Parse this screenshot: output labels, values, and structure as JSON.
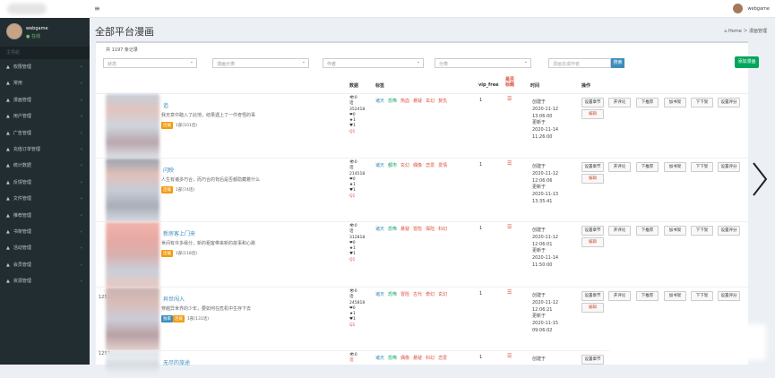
{
  "header": {
    "menu_icon": "≡",
    "user_name": "webgame"
  },
  "sidebar": {
    "user": {
      "name": "webgame",
      "status": "● 在线"
    },
    "nav_header": "主导航",
    "items": [
      {
        "icon": "▲",
        "label": "权限管理"
      },
      {
        "icon": "▲",
        "label": "常用"
      },
      {
        "icon": "▲",
        "label": "漫画管理"
      },
      {
        "icon": "▲",
        "label": "用户管理"
      },
      {
        "icon": "▲",
        "label": "广告管理"
      },
      {
        "icon": "▲",
        "label": "充值订单管理"
      },
      {
        "icon": "▲",
        "label": "统计数据"
      },
      {
        "icon": "▲",
        "label": "反馈管理"
      },
      {
        "icon": "▲",
        "label": "文件管理"
      },
      {
        "icon": "▲",
        "label": "推荐管理"
      },
      {
        "icon": "▲",
        "label": "书架管理"
      },
      {
        "icon": "▲",
        "label": "活动管理"
      },
      {
        "icon": "▲",
        "label": "会员管理"
      },
      {
        "icon": "▲",
        "label": "资源管理"
      }
    ]
  },
  "page": {
    "title": "全部平台漫画",
    "breadcrumb": "⌂ Home ＞ 漫画管理"
  },
  "toolbar": {
    "count": "共 1197 条记录",
    "filters": [
      "状态",
      "漫画分类",
      "作者",
      "分类"
    ],
    "keyword_placeholder": "漫画名或作者",
    "search_label": "搜索",
    "add_label": "添加漫画"
  },
  "table": {
    "headers": {
      "stats": "数据",
      "tags": "标签",
      "vip": "vip_free",
      "mark": "是否标题",
      "time": "时间",
      "ops": "操作"
    },
    "rows": [
      {
        "id": "",
        "title": "追",
        "intro": "我无意中踏入了此地，结果遇上了一件奇怪的事",
        "badges": [
          "连载"
        ],
        "note": "1部(101话)",
        "stats": [
          "👁0",
          "话",
          "352418",
          "❤0",
          "★1",
          "♥1",
          "Q1"
        ],
        "tags": [
          [
            "诸天",
            "blue"
          ],
          [
            "恐怖",
            "green"
          ],
          [
            "热血",
            "red"
          ],
          [
            "悬疑",
            "red"
          ],
          [
            "玄幻",
            "red"
          ],
          [
            "复仇",
            "red"
          ]
        ],
        "vip": "1",
        "mark": "☰",
        "times": [
          "创建于",
          "2020-11-12",
          "13:06:00",
          "更新于",
          "2020-11-14",
          "11:26:00"
        ],
        "ops": [
          "设置章节",
          "开评论",
          "下推荐",
          "加书架",
          "下下架",
          "设置评分",
          "编辑"
        ]
      },
      {
        "id": "",
        "title": "闪映",
        "intro": "人生有诸多巧合，而巧合的背后是否都隐藏着什么",
        "badges": [
          "连载"
        ],
        "note": "1部(74话)",
        "stats": [
          "👁0",
          "话",
          "214518",
          "❤0",
          "★1",
          "♥1",
          "Q1"
        ],
        "tags": [
          [
            "诸天",
            "blue"
          ],
          [
            "都市",
            "green"
          ],
          [
            "玄幻",
            "red"
          ],
          [
            "偶像",
            "red"
          ],
          [
            "恋爱",
            "red"
          ],
          [
            "爱情",
            "red"
          ]
        ],
        "vip": "1",
        "mark": "☰",
        "times": [
          "创建于",
          "2020-11-12",
          "12:06:06",
          "更新于",
          "2020-11-13",
          "13:35:41"
        ],
        "ops": [
          "设置章节",
          "开评论",
          "下推荐",
          "加书架",
          "下下架",
          "设置评分",
          "编辑"
        ]
      },
      {
        "id": "",
        "title": "新房客上门来",
        "intro": "世间有许多缘分，新的租客带来新的故事和心跳",
        "badges": [
          "连载"
        ],
        "note": "1部(118话)",
        "stats": [
          "👁0",
          "话",
          "312818",
          "❤0",
          "★1",
          "♥1",
          "Q1"
        ],
        "tags": [
          [
            "诸天",
            "blue"
          ],
          [
            "恐怖",
            "green"
          ],
          [
            "悬疑",
            "red"
          ],
          [
            "冒险",
            "red"
          ],
          [
            "探险",
            "red"
          ],
          [
            "科幻",
            "red"
          ]
        ],
        "vip": "1",
        "mark": "☰",
        "times": [
          "创建于",
          "2020-11-12",
          "12:06:01",
          "更新于",
          "2020-11-14",
          "11:50:00"
        ],
        "ops": [
          "设置章节",
          "开评论",
          "下推荐",
          "加书架",
          "下下架",
          "设置评分",
          "编辑"
        ]
      },
      {
        "id": "1257",
        "title": "异世闯入",
        "intro": "穿越异世界的少年，要如何在危机中生存下去",
        "badges": [
          "独家",
          "连载"
        ],
        "note": "1部(131话)",
        "stats": [
          "👁0",
          "话",
          "245818",
          "❤0",
          "★1",
          "♥1",
          "Q1"
        ],
        "tags": [
          [
            "诸天",
            "blue"
          ],
          [
            "恐怖",
            "green"
          ],
          [
            "冒险",
            "red"
          ],
          [
            "古代",
            "red"
          ],
          [
            "奇幻",
            "red"
          ],
          [
            "玄幻",
            "red"
          ]
        ],
        "vip": "1",
        "mark": "☰",
        "times": [
          "创建于",
          "2020-11-12",
          "12:06:21",
          "更新于",
          "2020-11-15",
          "09:06:02"
        ],
        "ops": [
          "设置章节",
          "开评论",
          "下推荐",
          "加书架",
          "下下架",
          "设置评分",
          "编辑"
        ]
      },
      {
        "id": "1257",
        "title": "无尽的旅途",
        "intro": "",
        "badges": [],
        "note": "",
        "stats": [
          "👁0",
          "话"
        ],
        "tags": [
          [
            "诸天",
            "blue"
          ],
          [
            "恐怖",
            "green"
          ],
          [
            "偶像",
            "red"
          ],
          [
            "悬疑",
            "red"
          ],
          [
            "科幻",
            "red"
          ],
          [
            "恋爱",
            "red"
          ]
        ],
        "vip": "1",
        "mark": "☰",
        "times": [
          "创建于"
        ],
        "ops": [
          "设置章节"
        ]
      }
    ]
  },
  "colors": {
    "sidebar": "#222d32",
    "primary": "#3c8dbc",
    "success": "#00a65a",
    "danger": "#dd4b39",
    "warning": "#f39c12"
  },
  "icons": {
    "next": "chevron-right-icon"
  }
}
